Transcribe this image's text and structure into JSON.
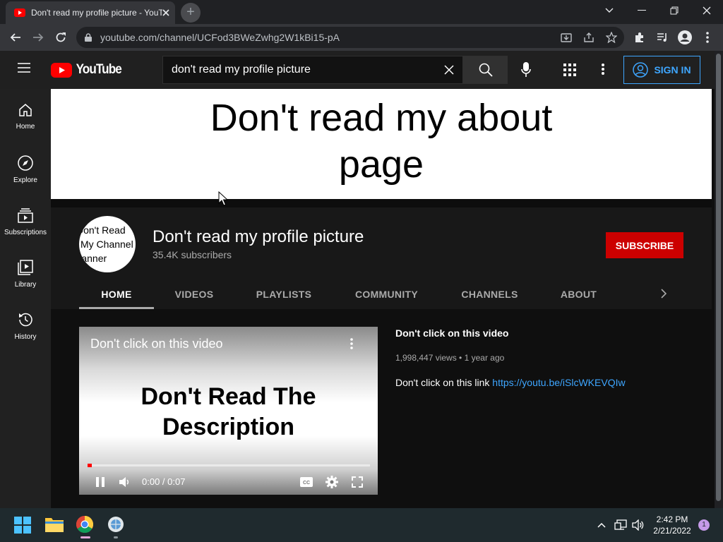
{
  "browser": {
    "tab_title": "Don't read my profile picture - YouTube",
    "url": "youtube.com/channel/UCFod3BWeZwhg2W1kBi15-pA"
  },
  "youtube": {
    "logo_text": "YouTube",
    "search_query": "don't read my profile picture",
    "sign_in": "SIGN IN",
    "sidebar": [
      {
        "label": "Home",
        "icon": "home-icon"
      },
      {
        "label": "Explore",
        "icon": "explore-icon"
      },
      {
        "label": "Subscriptions",
        "icon": "subscriptions-icon"
      },
      {
        "label": "Library",
        "icon": "library-icon"
      },
      {
        "label": "History",
        "icon": "history-icon"
      }
    ],
    "banner": {
      "line1": "Don't read my about",
      "line2": "page"
    },
    "channel": {
      "avatar_lines": [
        "Don't Read",
        "My Channel",
        "Banner"
      ],
      "name": "Don't read my profile picture",
      "subscribers": "35.4K subscribers",
      "subscribe": "SUBSCRIBE"
    },
    "tabs": [
      "HOME",
      "VIDEOS",
      "PLAYLISTS",
      "COMMUNITY",
      "CHANNELS",
      "ABOUT"
    ],
    "active_tab": "HOME",
    "video": {
      "overlay_title": "Don't click on this video",
      "thumb_line1": "Don't Read The",
      "thumb_line2": "Description",
      "time": "0:00 / 0:07",
      "progress": 0.01,
      "title": "Don't click on this video",
      "meta": "1,998,447 views • 1 year ago",
      "desc_text": "Don't click on this link ",
      "desc_link": "https://youtu.be/iSlcWKEVQIw"
    }
  },
  "taskbar": {
    "time": "2:42 PM",
    "date": "2/21/2022",
    "notifications": "1"
  },
  "colors": {
    "accent": "#cc0000",
    "link": "#3ea6ff"
  }
}
